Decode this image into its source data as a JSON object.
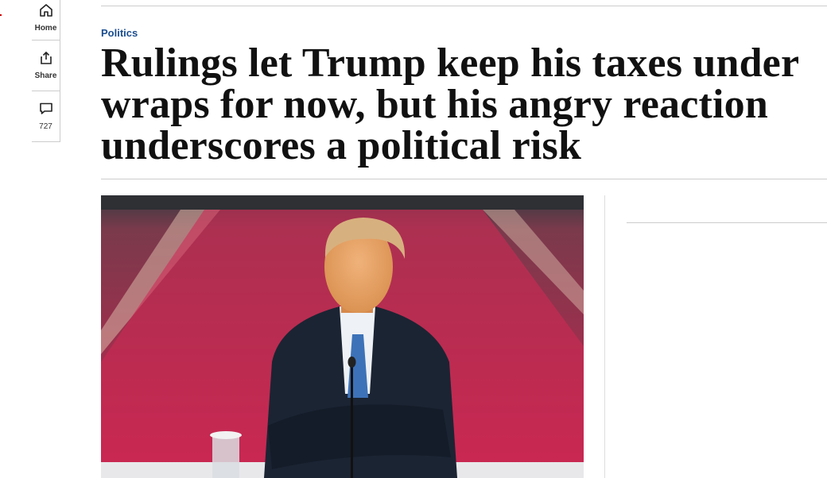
{
  "rail": {
    "home_label": "Home",
    "share_label": "Share",
    "comments_count": "727"
  },
  "article": {
    "kicker": "Politics",
    "headline": "Rulings let Trump keep his taxes under wraps for now, but his angry reaction underscores a political risk"
  },
  "icons": [
    "home-icon",
    "share-icon",
    "comment-icon"
  ],
  "colors": {
    "kicker": "#1a4d8f",
    "rule": "#cccccc"
  }
}
